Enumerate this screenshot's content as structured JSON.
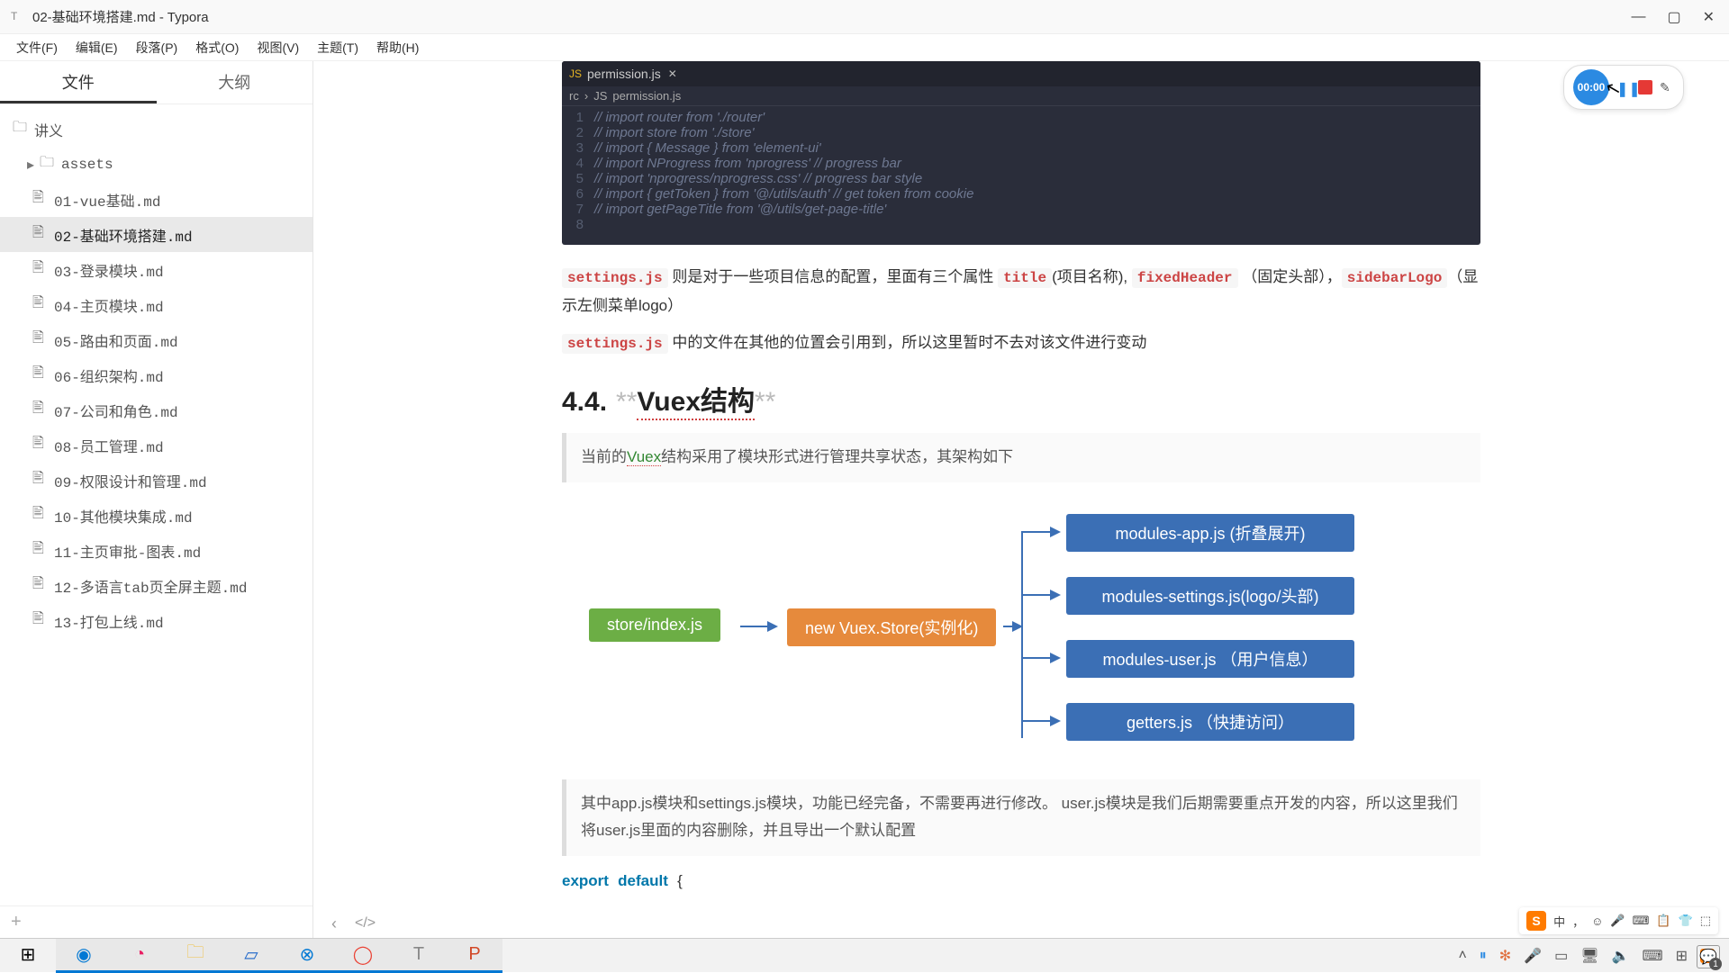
{
  "window": {
    "title": "02-基础环境搭建.md - Typora"
  },
  "win_buttons": {
    "min": "—",
    "max": "▢",
    "close": "✕"
  },
  "menu": [
    "文件(F)",
    "编辑(E)",
    "段落(P)",
    "格式(O)",
    "视图(V)",
    "主题(T)",
    "帮助(H)"
  ],
  "sidebar": {
    "tabs": [
      "文件",
      "大纲"
    ],
    "root": "讲义",
    "folder": "assets",
    "files": [
      "01-vue基础.md",
      "02-基础环境搭建.md",
      "03-登录模块.md",
      "04-主页模块.md",
      "05-路由和页面.md",
      "06-组织架构.md",
      "07-公司和角色.md",
      "08-员工管理.md",
      "09-权限设计和管理.md",
      "10-其他模块集成.md",
      "11-主页审批-图表.md",
      "12-多语言tab页全屏主题.md",
      "13-打包上线.md"
    ],
    "active_index": 1
  },
  "recorder": {
    "timer": "00:00"
  },
  "code": {
    "filename": "permission.js",
    "breadcrumb": [
      "rc",
      "permission.js"
    ],
    "lines": [
      "// import router from './router'",
      "// import store from './store'",
      "// import { Message } from 'element-ui'",
      "// import NProgress from 'nprogress' // progress bar",
      "// import 'nprogress/nprogress.css' // progress bar style",
      "// import { getToken } from '@/utils/auth' // get token from cookie",
      "// import getPageTitle from '@/utils/get-page-title'",
      ""
    ]
  },
  "para1": {
    "c1": "settings.js",
    "t1": " 则是对于一些项目信息的配置，里面有三个属性 ",
    "c2": "title",
    "t2": "(项目名称), ",
    "c3": "fixedHeader",
    "t3": " （固定头部），",
    "c4": "sidebarLogo",
    "t4": "（显示左侧菜单logo）"
  },
  "para2": {
    "c1": "settings.js",
    "t1": " 中的文件在其他的位置会引用到，所以这里暂时不去对该文件进行变动"
  },
  "heading": {
    "num": "4.4.",
    "stars": "**",
    "text": "Vuex结构"
  },
  "quote1": {
    "t1": "当前的",
    "ul": "Vuex",
    "t2": "结构采用了模块形式进行管理共享状态，其架构如下"
  },
  "diagram": {
    "store": "store/index.js",
    "vuex": "new Vuex.Store(实例化)",
    "m1": "modules-app.js (折叠展开)",
    "m2": "modules-settings.js(logo/头部)",
    "m3": "modules-user.js （用户信息）",
    "m4": "getters.js （快捷访问）"
  },
  "quote2": "其中app.js模块和settings.js模块，功能已经完备，不需要再进行修改。 user.js模块是我们后期需要重点开发的内容，所以这里我们将user.js里面的内容删除，并且导出一个默认配置",
  "export_line": {
    "kw1": "export",
    "kw2": "default",
    "rest": "  {"
  },
  "chart_data": {
    "type": "diagram",
    "nodes": [
      {
        "id": "store",
        "label": "store/index.js",
        "color": "#6cae45"
      },
      {
        "id": "vuex",
        "label": "new Vuex.Store(实例化)",
        "color": "#e68a3c"
      },
      {
        "id": "m1",
        "label": "modules-app.js (折叠展开)",
        "color": "#3b6fb5"
      },
      {
        "id": "m2",
        "label": "modules-settings.js(logo/头部)",
        "color": "#3b6fb5"
      },
      {
        "id": "m3",
        "label": "modules-user.js （用户信息）",
        "color": "#3b6fb5"
      },
      {
        "id": "m4",
        "label": "getters.js （快捷访问）",
        "color": "#3b6fb5"
      }
    ],
    "edges": [
      {
        "from": "store",
        "to": "vuex"
      },
      {
        "from": "vuex",
        "to": "m1"
      },
      {
        "from": "vuex",
        "to": "m2"
      },
      {
        "from": "vuex",
        "to": "m3"
      },
      {
        "from": "vuex",
        "to": "m4"
      }
    ]
  },
  "sogou_tray": [
    "中",
    "，",
    "☺",
    "🎤",
    "⌨",
    "📋",
    "👕",
    "⬚"
  ],
  "tray_icons": [
    "˄",
    "⏸",
    "✻",
    "🎤",
    "▭",
    "🖥",
    "🔈",
    "⌨",
    "⊞",
    "S",
    "💬"
  ],
  "notif_count": "1"
}
